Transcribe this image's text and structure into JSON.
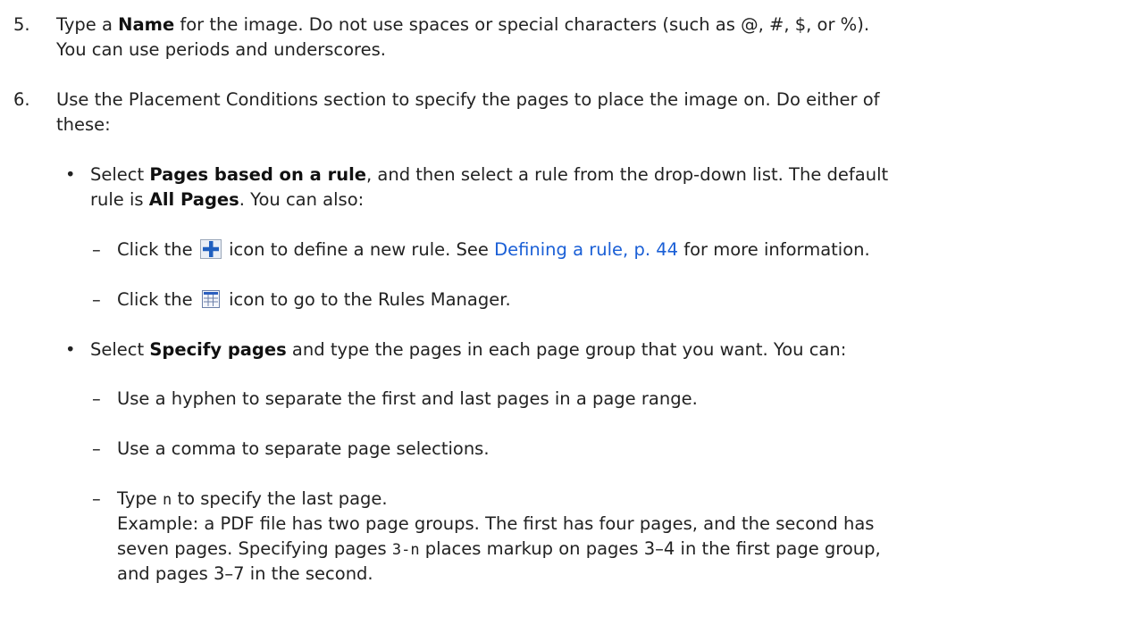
{
  "step5": {
    "number": "5.",
    "pre": "Type a ",
    "name_bold": "Name",
    "post": " for the image. Do not use spaces or special characters (such as @, #, $, or %).",
    "line2": "You can use periods and underscores."
  },
  "step6": {
    "number": "6.",
    "line1": "Use the Placement Conditions section to specify the pages to place the image on. Do either of",
    "line2": "these:"
  },
  "bullet1": {
    "marker": "•",
    "pre": "Select ",
    "bold": "Pages based on a rule",
    "post": ", and then select a rule from the drop-down list. The default",
    "line2_pre": "rule is ",
    "line2_bold": "All Pages",
    "line2_post": ". You can also:"
  },
  "sub_add": {
    "dash": "–",
    "pre": "Click the ",
    "icon": "plus-icon",
    "mid": " icon to define a new rule. See ",
    "link": "Defining a rule, p. 44",
    "post": " for more information."
  },
  "sub_rules": {
    "dash": "–",
    "pre": "Click the ",
    "icon": "grid-icon",
    "post": " icon to go to the Rules Manager."
  },
  "bullet2": {
    "marker": "•",
    "pre": "Select ",
    "bold": "Specify pages",
    "post": " and type the pages in each page group that you want. You can:"
  },
  "sub_hyphen": {
    "dash": "–",
    "text": "Use a hyphen to separate the first and last pages in a page range."
  },
  "sub_comma": {
    "dash": "–",
    "text": "Use a comma to separate page selections."
  },
  "sub_n": {
    "dash": "–",
    "pre": "Type ",
    "code": "n",
    "post": " to specify the last page.",
    "ex_line1": "Example: a PDF file has two page groups. The first has four pages, and the second has",
    "ex_line2_pre": "seven pages. Specifying pages ",
    "ex_code": "3-n",
    "ex_line2_post": " places markup on pages 3–4 in the first page group,",
    "ex_line3": "and pages 3–7 in the second."
  },
  "colors": {
    "link": "#1a5fd6",
    "icon_blue": "#1f5fbf"
  }
}
